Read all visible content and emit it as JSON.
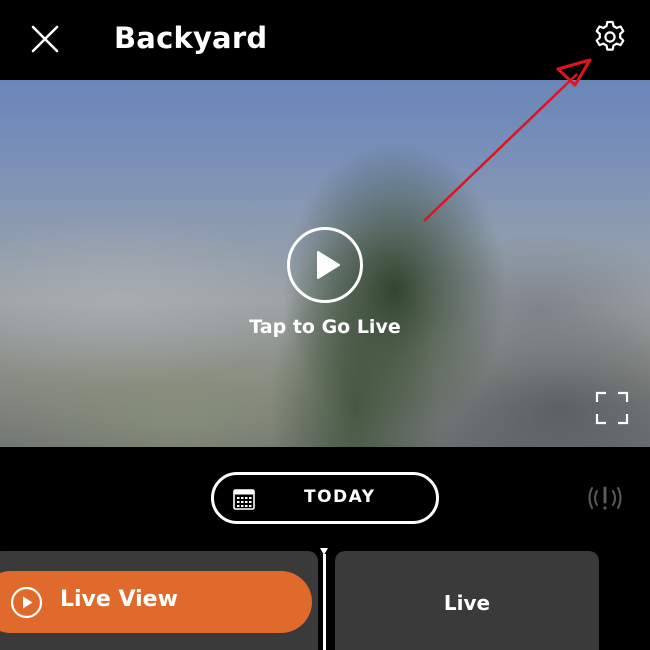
{
  "header": {
    "title": "Backyard",
    "close_icon": "close-icon",
    "settings_icon": "gear-icon"
  },
  "video": {
    "tap_label": "Tap to Go Live",
    "play_icon": "play-icon",
    "fullscreen_icon": "fullscreen-icon"
  },
  "date_bar": {
    "today_label": "TODAY",
    "calendar_icon": "calendar-icon",
    "alert_icon": "siren-alert-icon"
  },
  "timeline": {
    "live_view_label": "Live View",
    "live_label": "Live"
  },
  "colors": {
    "accent": "#e06a2c",
    "background": "#000000",
    "clip": "#3a3a3a",
    "annotation": "#e0141e"
  }
}
